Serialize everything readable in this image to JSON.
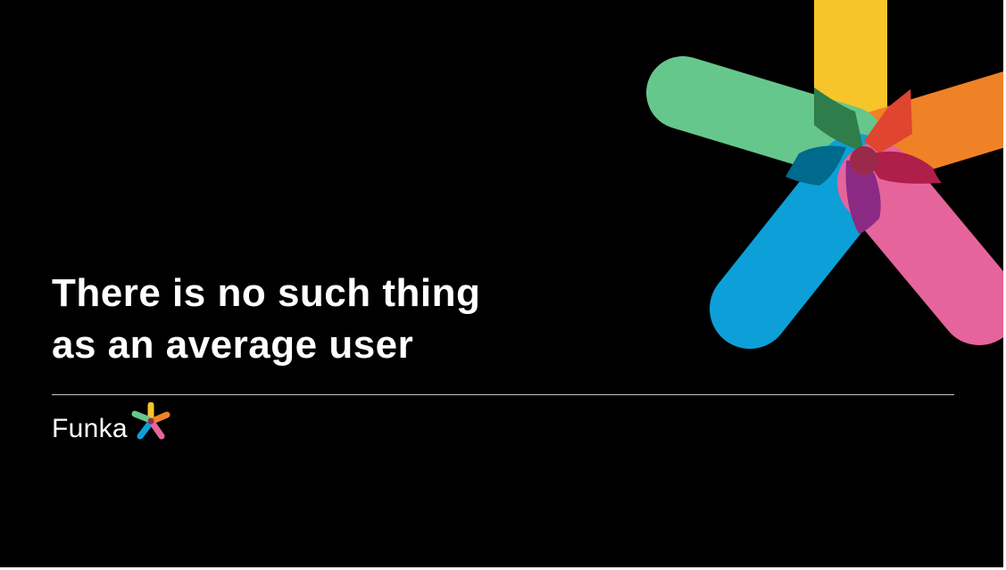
{
  "slide": {
    "headline_line1": "There is no such thing",
    "headline_line2": "as an average user"
  },
  "logo": {
    "text": "Funka",
    "mark_icon": "funka-star-icon"
  },
  "colors": {
    "background": "#000000",
    "text": "#ffffff",
    "petal_yellow": "#f7c42a",
    "petal_orange": "#ef8226",
    "petal_green": "#66c78c",
    "petal_blue": "#0d9fd8",
    "petal_pink": "#e5649c"
  }
}
